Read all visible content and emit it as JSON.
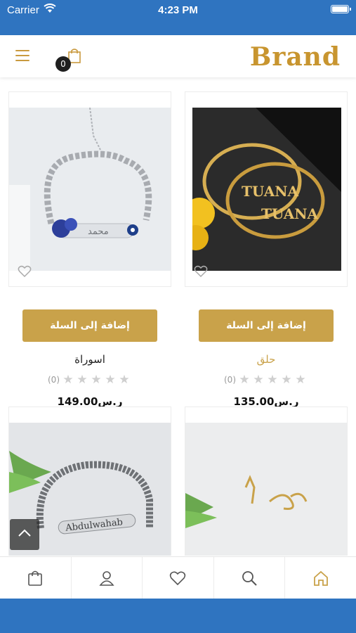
{
  "status_bar": {
    "carrier": "Carrier",
    "time": "4:23 PM"
  },
  "header": {
    "brand": "Brand",
    "cart_count": "0"
  },
  "products": [
    {
      "name": "حلق",
      "price": "135.00ر.س",
      "rating_count": "(0)",
      "add_label": "إضافة إلى السلة",
      "image_text": "TUANA"
    },
    {
      "name": "اسوراة",
      "price": "149.00ر.س",
      "rating_count": "(0)",
      "add_label": "إضافة إلى السلة",
      "image_text": "محمد"
    },
    {
      "name": "",
      "image_text": ""
    },
    {
      "name": "",
      "image_text": "Abdulwahab"
    }
  ],
  "tabbar": [
    "home-icon",
    "search-icon",
    "heart-icon",
    "user-icon",
    "bag-icon"
  ],
  "colors": {
    "accent": "#c9a24a",
    "status_bar": "#2f74c0",
    "brand": "#c8952f"
  }
}
